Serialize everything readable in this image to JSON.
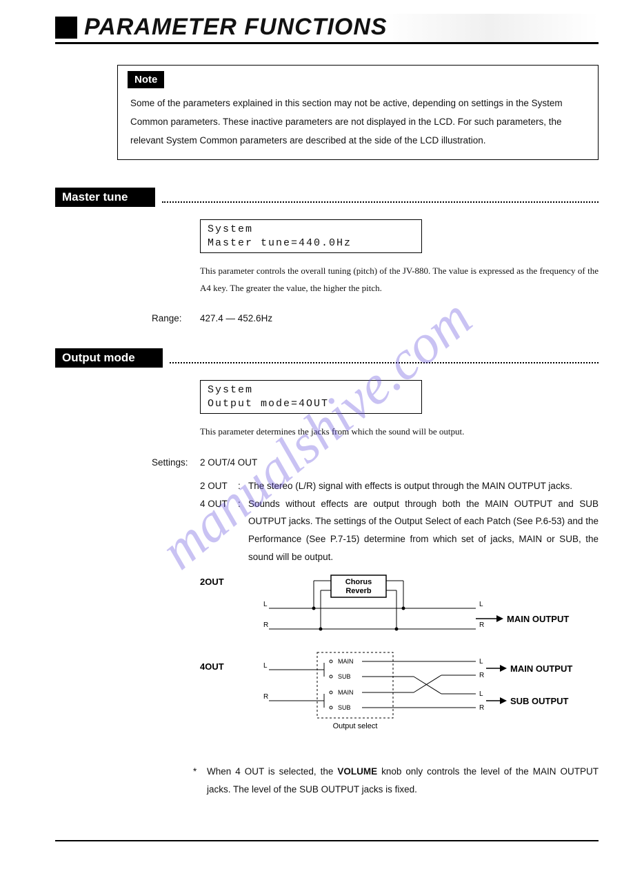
{
  "title": "PARAMETER FUNCTIONS",
  "note": {
    "label": "Note",
    "body": "Some of the parameters explained in this section may not be active, depending on settings in the System Common parameters. These inactive parameters are not displayed in the LCD. For such parameters, the relevant System Common parameters are described at the side of the LCD illustration."
  },
  "watermark": "manualshive.com",
  "master_tune": {
    "heading": "Master tune",
    "lcd_line1": "System",
    "lcd_line2": "Master tune=440.0Hz",
    "desc": "This parameter controls the overall tuning (pitch) of the JV-880. The value is expressed as the frequency of the A4 key. The greater the value, the higher the pitch.",
    "range_label": "Range:",
    "range_value": "427.4 — 452.6Hz"
  },
  "output_mode": {
    "heading": "Output mode",
    "lcd_line1": "System",
    "lcd_line2": "Output mode=4OUT",
    "desc": "This parameter determines the jacks from which the sound will be output.",
    "settings_label": "Settings:",
    "settings_value": "2 OUT/4 OUT",
    "opt1_key": "2 OUT",
    "opt1_val": "The stereo (L/R) signal with effects is output through the MAIN OUTPUT jacks.",
    "opt2_key": "4 OUT",
    "opt2_val": "Sounds without effects are output through both the MAIN OUTPUT and SUB OUTPUT jacks. The settings of the Output Select of each Patch (See P.6-53) and the Performance (See P.7-15) determine from which set of jacks, MAIN or SUB, the sound will be output.",
    "diag2out_label": "2OUT",
    "diag4out_label": "4OUT",
    "diag_chorus_line1": "Chorus",
    "diag_chorus_line2": "Reverb",
    "diag_main_output": "MAIN OUTPUT",
    "diag_sub_output": "SUB OUTPUT",
    "diag_L": "L",
    "diag_R": "R",
    "diag_MAIN": "MAIN",
    "diag_SUB": "SUB",
    "diag_out_select": "Output select",
    "footnote_pre": "When 4 OUT is selected, the ",
    "footnote_bold": "VOLUME",
    "footnote_post": " knob only controls the level of the MAIN OUTPUT jacks. The level of the SUB OUTPUT jacks is fixed."
  }
}
